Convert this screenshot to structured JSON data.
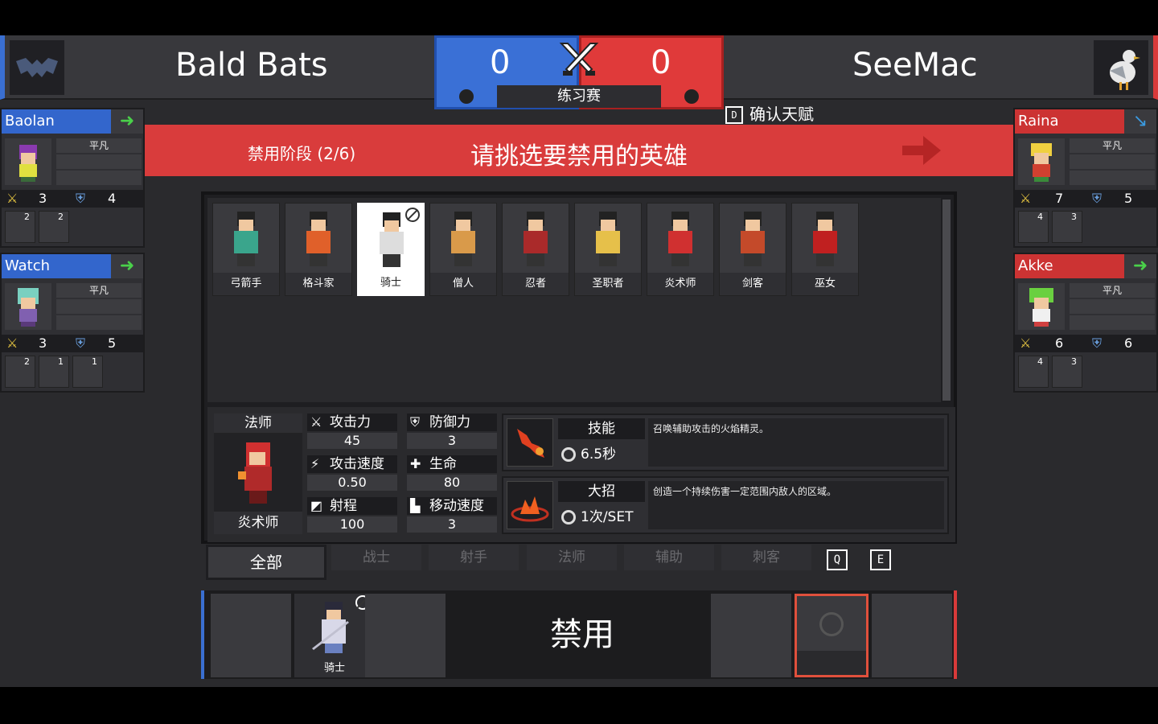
{
  "match": {
    "left_team": "Bald Bats",
    "right_team": "SeeMac",
    "left_score": "0",
    "right_score": "0",
    "mode": "练习赛"
  },
  "confirm": {
    "key": "D",
    "label": "确认天赋"
  },
  "banner": {
    "phase": "禁用阶段 (2/6)",
    "title": "请挑选要禁用的英雄"
  },
  "left_players": [
    {
      "name": "Baolan",
      "tier": "平凡",
      "atk": "3",
      "def": "4",
      "minis": [
        "2",
        "2"
      ]
    },
    {
      "name": "Watch",
      "tier": "平凡",
      "atk": "3",
      "def": "5",
      "minis": [
        "2",
        "1",
        "1"
      ]
    }
  ],
  "right_players": [
    {
      "name": "Raina",
      "tier": "平凡",
      "atk": "7",
      "def": "5",
      "minis": [
        "4",
        "3"
      ]
    },
    {
      "name": "Akke",
      "tier": "平凡",
      "atk": "6",
      "def": "6",
      "minis": [
        "4",
        "3"
      ]
    }
  ],
  "heroes": [
    {
      "label": "弓箭手",
      "color": "#3aa58c"
    },
    {
      "label": "格斗家",
      "color": "#e0602a"
    },
    {
      "label": "骑士",
      "color": "#dddddd"
    },
    {
      "label": "僧人",
      "color": "#d99a4a"
    },
    {
      "label": "忍者",
      "color": "#aa2a2a"
    },
    {
      "label": "圣职者",
      "color": "#e6c04a"
    },
    {
      "label": "炎术师",
      "color": "#d03030"
    },
    {
      "label": "剑客",
      "color": "#c44a2a"
    },
    {
      "label": "巫女",
      "color": "#c02020"
    }
  ],
  "details": {
    "class": "法师",
    "hero": "炎术师",
    "stats": {
      "atk_label": "攻击力",
      "atk": "45",
      "def_label": "防御力",
      "def": "3",
      "aspd_label": "攻击速度",
      "aspd": "0.50",
      "hp_label": "生命",
      "hp": "80",
      "range_label": "射程",
      "range": "100",
      "move_label": "移动速度",
      "move": "3"
    },
    "skill": {
      "name": "技能",
      "cd": "6.5秒",
      "desc": "召唤辅助攻击的火焰精灵。"
    },
    "ult": {
      "name": "大招",
      "cd": "1次/SET",
      "desc": "创造一个持续伤害一定范围内敌人的区域。"
    }
  },
  "tabs": {
    "all": "全部",
    "warrior": "战士",
    "archer": "射手",
    "mage": "法师",
    "support": "辅助",
    "assassin": "刺客",
    "key_q": "Q",
    "key_e": "E"
  },
  "bans": {
    "center": "禁用",
    "left_ban_label": "骑士"
  }
}
